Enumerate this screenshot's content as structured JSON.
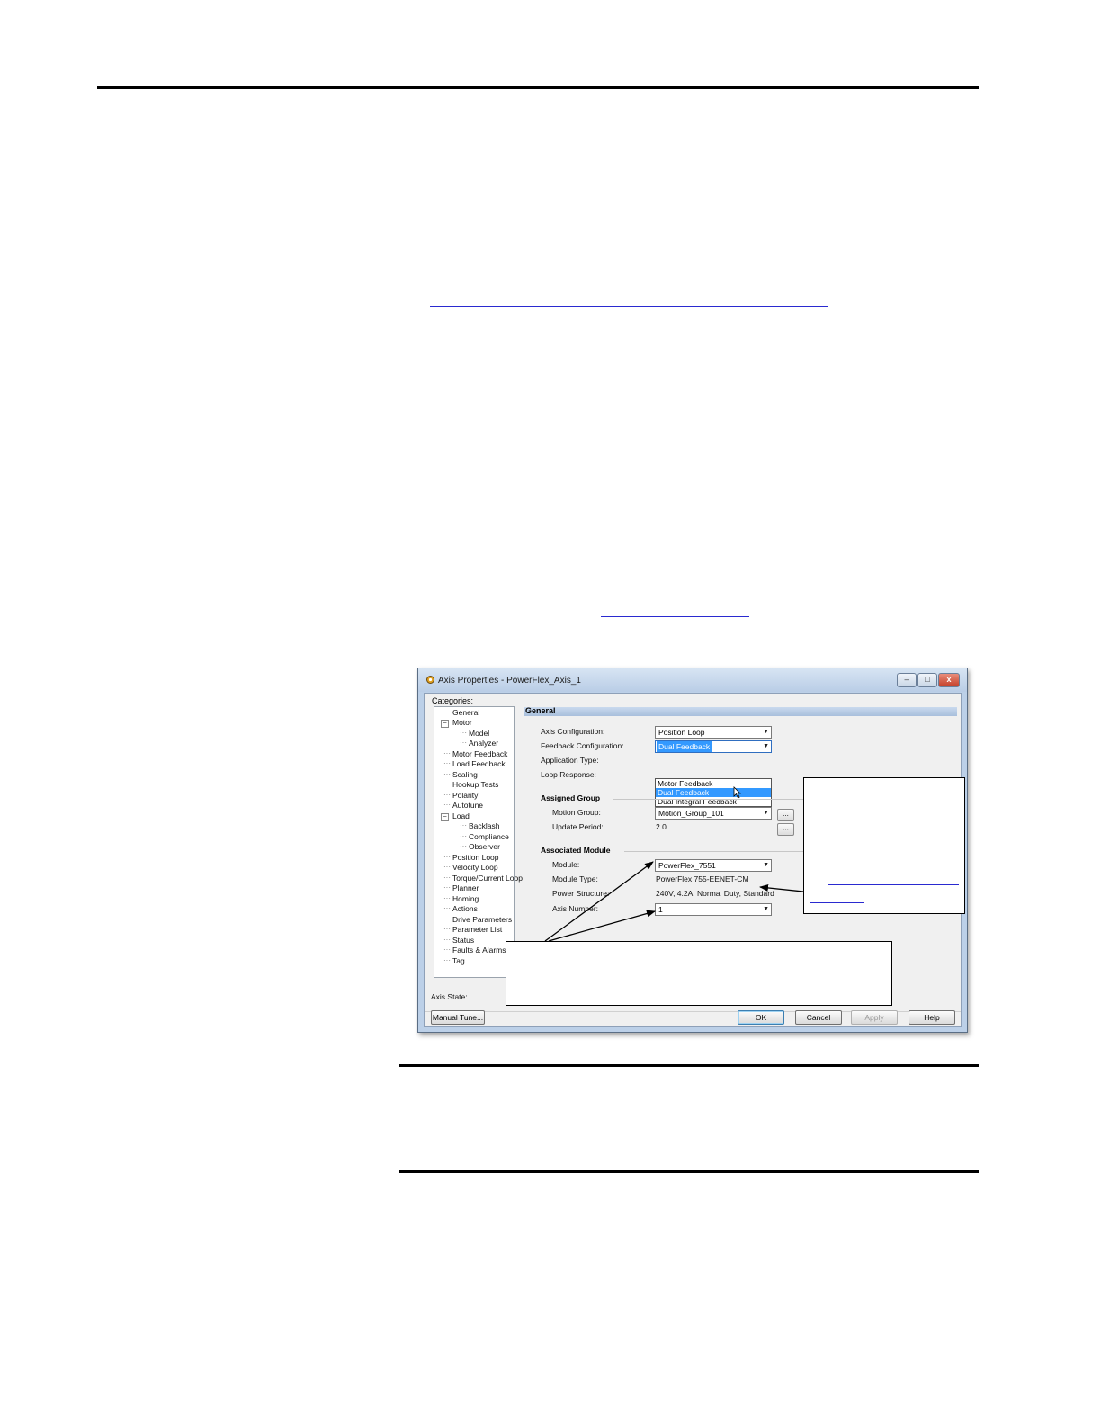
{
  "dialog": {
    "title": "Axis Properties - PowerFlex_Axis_1",
    "window_buttons": {
      "minimize": "–",
      "maximize": "□",
      "close": "x"
    },
    "categories_label": "Categories:",
    "tree": {
      "general": "General",
      "motor": "Motor",
      "model": "Model",
      "analyzer": "Analyzer",
      "motor_feedback": "Motor Feedback",
      "load_feedback": "Load Feedback",
      "scaling": "Scaling",
      "hookup_tests": "Hookup Tests",
      "polarity": "Polarity",
      "autotune": "Autotune",
      "load": "Load",
      "backlash": "Backlash",
      "compliance": "Compliance",
      "observer": "Observer",
      "position_loop": "Position Loop",
      "velocity_loop": "Velocity Loop",
      "torque_current_loop": "Torque/Current Loop",
      "planner": "Planner",
      "homing": "Homing",
      "actions": "Actions",
      "drive_parameters": "Drive Parameters",
      "parameter_list": "Parameter List",
      "status": "Status",
      "faults_alarms": "Faults & Alarms",
      "tag": "Tag"
    },
    "section_title": "General",
    "axis_configuration": {
      "label": "Axis Configuration:",
      "value": "Position Loop"
    },
    "feedback_configuration": {
      "label": "Feedback Configuration:",
      "value": "Dual Feedback"
    },
    "feedback_options": [
      "Motor Feedback",
      "Dual Feedback",
      "Dual Integral Feedback"
    ],
    "application_type": {
      "label": "Application Type:"
    },
    "loop_response": {
      "label": "Loop Response:"
    },
    "assigned_group": {
      "title": "Assigned Group",
      "motion_group": {
        "label": "Motion Group:",
        "value": "Motion_Group_101"
      },
      "update_period": {
        "label": "Update Period:",
        "value": "2.0"
      }
    },
    "associated_module": {
      "title": "Associated Module",
      "module": {
        "label": "Module:",
        "value": "PowerFlex_7551"
      },
      "module_type": {
        "label": "Module Type:",
        "value": "PowerFlex 755-EENET-CM"
      },
      "power_structure": {
        "label": "Power Structure:",
        "value": "240V, 4.2A, Normal Duty, Standard"
      },
      "axis_number": {
        "label": "Axis Number:",
        "value": "1"
      }
    },
    "ellipsis": "...",
    "axis_state_label": "Axis State:",
    "buttons": {
      "manual_tune": "Manual Tune...",
      "ok": "OK",
      "cancel": "Cancel",
      "apply": "Apply",
      "help": "Help"
    }
  }
}
